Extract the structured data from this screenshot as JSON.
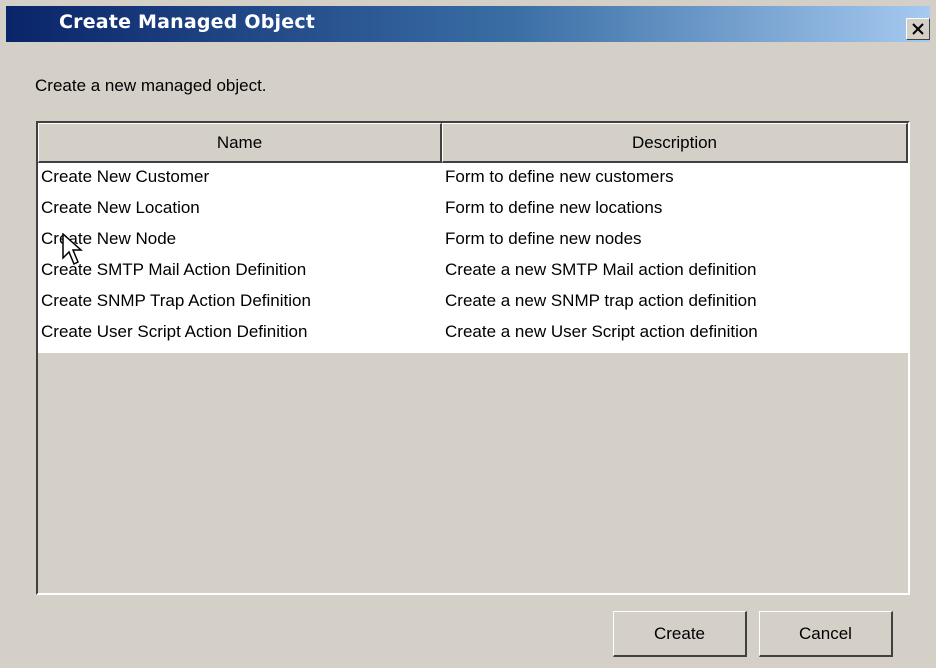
{
  "window": {
    "title": "Create Managed Object"
  },
  "dialog": {
    "description": "Create a new managed object."
  },
  "table": {
    "columns": [
      "Name",
      "Description"
    ],
    "rows": [
      {
        "name": "Create New Customer",
        "description": "Form to define new customers"
      },
      {
        "name": "Create New Location",
        "description": "Form to define new locations"
      },
      {
        "name": "Create New Node",
        "description": "Form to define new nodes"
      },
      {
        "name": "Create SMTP Mail Action Definition",
        "description": "Create a new SMTP Mail action definition"
      },
      {
        "name": "Create SNMP Trap Action Definition",
        "description": "Create a new SNMP trap action definition"
      },
      {
        "name": "Create User Script Action Definition",
        "description": "Create a new User Script action definition"
      }
    ]
  },
  "buttons": {
    "create": "Create",
    "cancel": "Cancel"
  },
  "icons": {
    "close": "close-icon",
    "cursor": "mouse-pointer-icon"
  }
}
